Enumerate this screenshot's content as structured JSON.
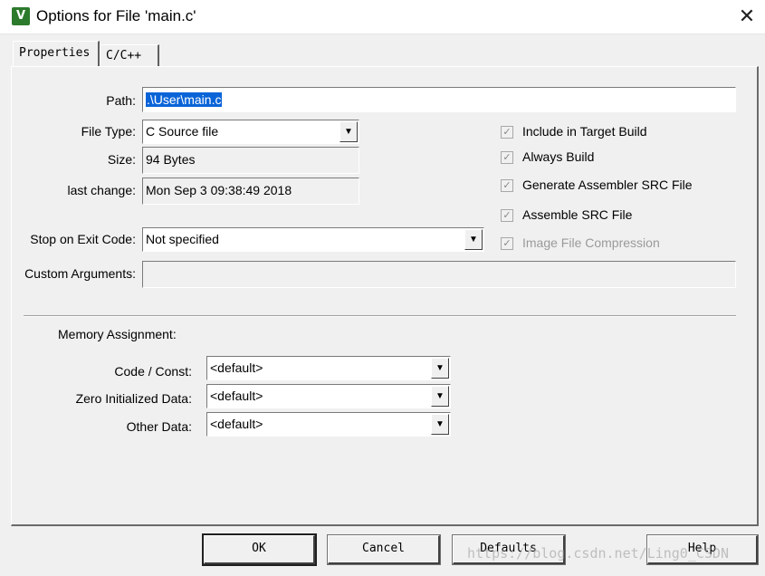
{
  "window": {
    "title": "Options for File 'main.c'",
    "icon": "uvision-app-icon",
    "icon_text": "V",
    "close_glyph": "✕"
  },
  "tabs": [
    {
      "label": "Properties",
      "active": true
    },
    {
      "label": "C/C++",
      "active": false
    }
  ],
  "properties": {
    "path_label": "Path:",
    "path_value": ".\\User\\main.c",
    "file_type_label": "File Type:",
    "file_type_value": "C Source file",
    "size_label": "Size:",
    "size_value": "94 Bytes",
    "last_change_label": "last change:",
    "last_change_value": "Mon Sep  3 09:38:49 2018",
    "stop_exit_label": "Stop on Exit Code:",
    "stop_exit_value": "Not specified",
    "custom_args_label": "Custom Arguments:",
    "custom_args_value": ""
  },
  "checkboxes": [
    {
      "label": "Include in Target Build",
      "checked": true,
      "enabled": true
    },
    {
      "label": "Always Build",
      "checked": true,
      "enabled": true
    },
    {
      "label": "Generate Assembler SRC File",
      "checked": true,
      "enabled": true
    },
    {
      "label": "Assemble SRC File",
      "checked": true,
      "enabled": true
    },
    {
      "label": "Image File Compression",
      "checked": true,
      "enabled": false
    }
  ],
  "check_glyph": "✓",
  "dropdown_glyph": "▼",
  "memory": {
    "heading": "Memory Assignment:",
    "code_const_label": "Code / Const:",
    "code_const_value": "<default>",
    "zero_init_label": "Zero Initialized Data:",
    "zero_init_value": "<default>",
    "other_data_label": "Other Data:",
    "other_data_value": "<default>"
  },
  "buttons": {
    "ok": "OK",
    "cancel": "Cancel",
    "defaults": "Defaults",
    "help": "Help"
  },
  "watermark": "https://blog.csdn.net/Ling0_CSDN"
}
